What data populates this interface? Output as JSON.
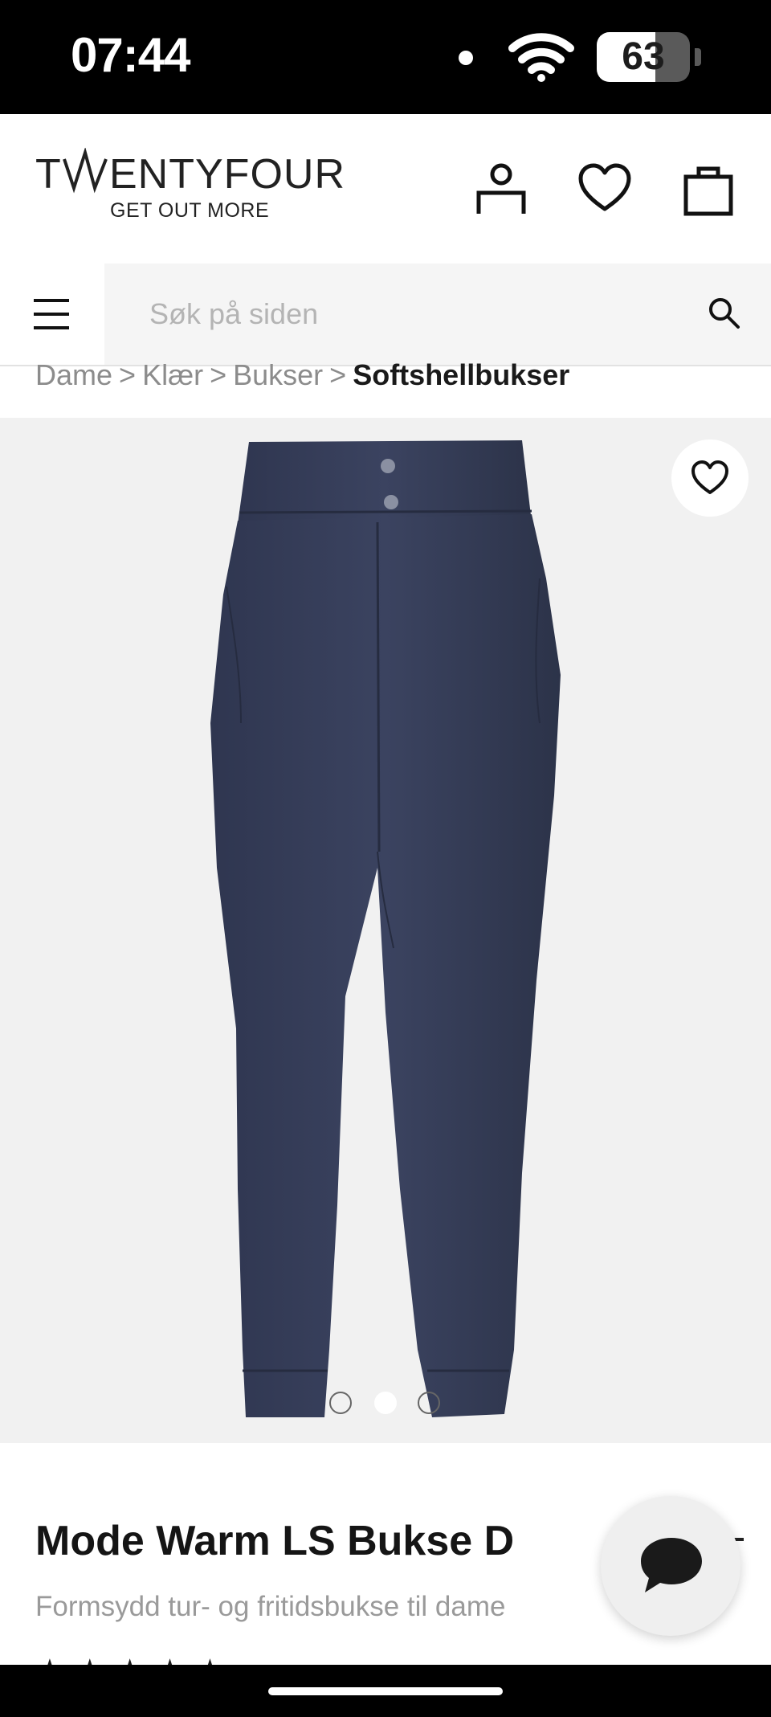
{
  "status_bar": {
    "time": "07:44",
    "battery_percent": 63
  },
  "header": {
    "logo_wordmark": "TWENTYFOUR",
    "logo_tagline": "GET OUT MORE",
    "icons": [
      "account-icon",
      "heart-icon",
      "bag-icon"
    ]
  },
  "search": {
    "placeholder": "Søk på siden",
    "value": ""
  },
  "breadcrumb": {
    "items": [
      "Dame",
      "Klær",
      "Bukser"
    ],
    "separator": ">",
    "current": "Softshellbukser"
  },
  "gallery": {
    "image_count": 3,
    "active_index": 1,
    "product_color": "#3a4258"
  },
  "product": {
    "title": "Mode Warm LS Bukse D",
    "subtitle": "Formsydd tur- og fritidsbukse til dame",
    "rating_stars": "★★★★★"
  },
  "colors": {
    "status_bar": "#000000",
    "search_bg": "#f5f5f5",
    "gallery_bg": "#f1f1f1"
  }
}
